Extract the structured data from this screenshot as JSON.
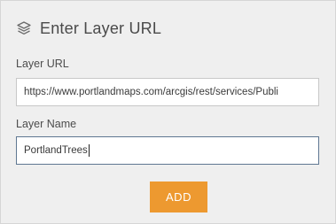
{
  "header": {
    "icon": "layers-icon",
    "title": "Enter Layer URL"
  },
  "layer_url": {
    "label": "Layer URL",
    "value": "https://www.portlandmaps.com/arcgis/rest/services/Publi"
  },
  "layer_name": {
    "label": "Layer Name",
    "value": "PortlandTrees"
  },
  "actions": {
    "add_label": "ADD"
  },
  "colors": {
    "accent": "#ed9930",
    "panel_bg": "#efefef",
    "active_border": "#5f7792"
  }
}
